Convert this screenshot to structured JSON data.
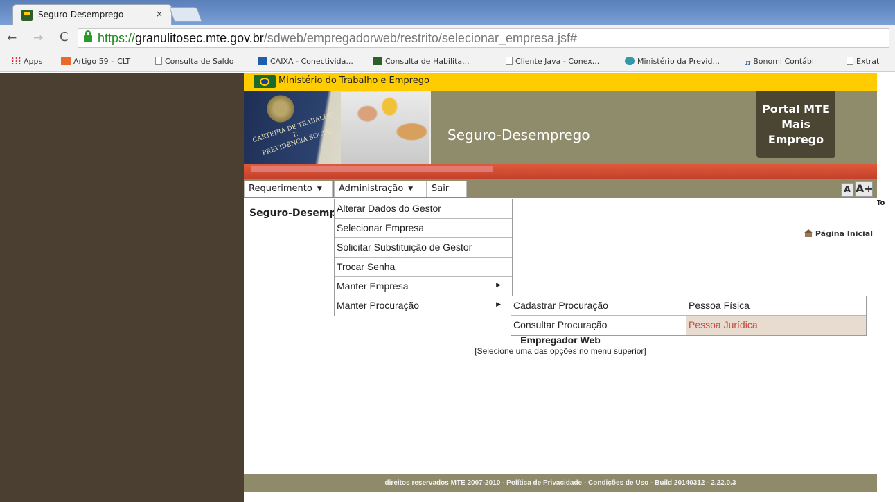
{
  "browser": {
    "tab_title": "Seguro-Desemprego",
    "tab_close": "×",
    "url_scheme": "https://",
    "url_host": "granulitosec.mte.gov.br",
    "url_path": "/sdweb/empregadorweb/restrito/selecionar_empresa.jsf#",
    "bookmarks": [
      {
        "label": "Apps",
        "icon": "apps-icon"
      },
      {
        "label": "Artigo 59 – CLT",
        "icon": "bookmark-icon"
      },
      {
        "label": "Consulta de Saldo",
        "icon": "page-icon"
      },
      {
        "label": "CAIXA - Conectivida...",
        "icon": "caixa-icon"
      },
      {
        "label": "Consulta de Habilita...",
        "icon": "mte-icon"
      },
      {
        "label": "Cliente Java - Conex...",
        "icon": "page-icon"
      },
      {
        "label": "Ministério da Previd...",
        "icon": "previdencia-icon"
      },
      {
        "label": "Bonomi Contábil",
        "icon": "pi-icon"
      },
      {
        "label": "Extrat",
        "icon": "page-icon"
      }
    ]
  },
  "site": {
    "ministry": "Ministério do Trabalho e Emprego",
    "carteira_text": "CARTEIRA DE TRABALHO\nE\nPREVIDÊNCIA SOCIAL",
    "title": "Seguro-Desemprego",
    "portal": "Portal MTE\nMais\nEmprego",
    "menu": {
      "requerimento": "Requerimento",
      "administracao": "Administração",
      "sair": "Sair"
    },
    "font_small": "A",
    "font_large": "A+",
    "cut_label": "To",
    "page_heading": "Seguro-Desemprego",
    "home_link": "Página Inicial",
    "admin_items": [
      "Alterar Dados do Gestor",
      "Selecionar Empresa",
      "Solicitar Substituição de Gestor",
      "Trocar Senha",
      "Manter Empresa",
      "Manter Procuração"
    ],
    "procuracao_items": [
      "Cadastrar Procuração",
      "Consultar Procuração"
    ],
    "pessoa_items": [
      "Pessoa Física",
      "Pessoa Jurídica"
    ],
    "center_title": "Empregador Web",
    "center_subtitle": "[Selecione uma das opções no menu superior]",
    "footer": "direitos reservados MTE 2007-2010 - Política de Privacidade - Condições de Uso - Build 20140312 - 2.22.0.3"
  },
  "colors": {
    "side_background": "#4a3f31",
    "menubar": "#8e8a6a",
    "topbar": "#ffcc00",
    "accent_stripe": "#c2402a",
    "hover_text": "#c44a3c"
  }
}
